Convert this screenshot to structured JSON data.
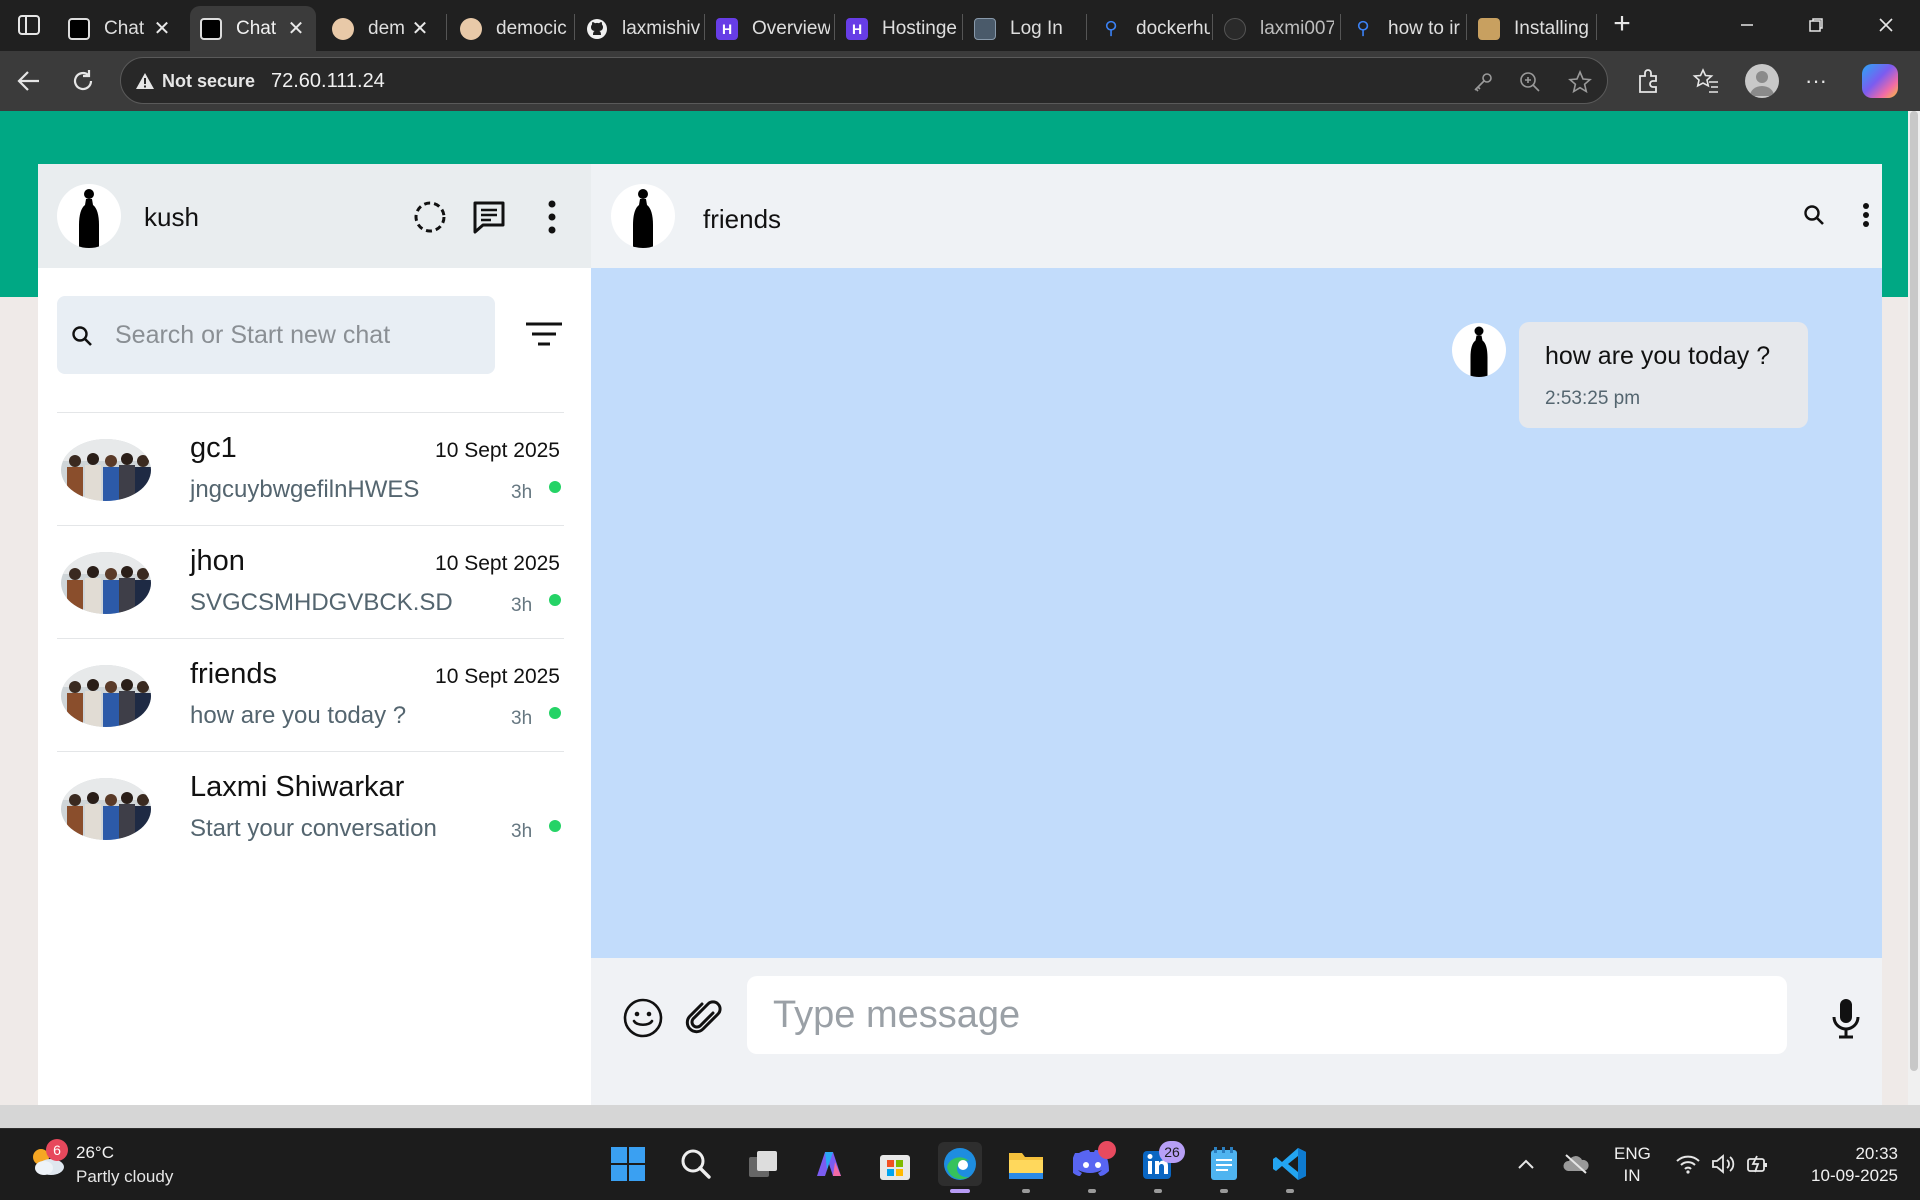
{
  "browser": {
    "tabs": [
      {
        "label": "Chat",
        "closable": true,
        "active": false
      },
      {
        "label": "Chat",
        "closable": true,
        "active": true
      },
      {
        "label": "dem",
        "closable": true,
        "active": false
      },
      {
        "label": "democic",
        "closable": false,
        "active": false
      },
      {
        "label": "laxmishiv",
        "closable": false,
        "active": false
      },
      {
        "label": "Overview",
        "closable": false,
        "active": false
      },
      {
        "label": "Hostinge",
        "closable": false,
        "active": false
      },
      {
        "label": "Log In",
        "closable": false,
        "active": false
      },
      {
        "label": "dockerhu",
        "closable": false,
        "active": false
      },
      {
        "label": "laxmi007",
        "closable": false,
        "active": false
      },
      {
        "label": "how to ir",
        "closable": false,
        "active": false
      },
      {
        "label": "Installing",
        "closable": false,
        "active": false
      }
    ],
    "security_label": "Not secure",
    "url": "72.60.111.24"
  },
  "app": {
    "colors": {
      "brand": "#00a884",
      "chat_bg": "#c2dcfb",
      "online": "#25d366"
    },
    "me": {
      "name": "kush"
    },
    "search": {
      "placeholder": "Search or Start new chat"
    },
    "chats": [
      {
        "name": "gc1",
        "date": "10 Sept 2025",
        "last_message": "jngcuybwgefilnHWES",
        "ago": "3h",
        "online": true
      },
      {
        "name": "jhon",
        "date": "10 Sept 2025",
        "last_message": "SVGCSMHDGVBCK.SD",
        "ago": "3h",
        "online": true
      },
      {
        "name": "friends",
        "date": "10 Sept 2025",
        "last_message": "how are you today ?",
        "ago": "3h",
        "online": true
      },
      {
        "name": "Laxmi Shiwarkar",
        "date": "",
        "last_message": "Start your conversation",
        "ago": "3h",
        "online": true
      }
    ],
    "active_chat": {
      "name": "friends",
      "messages": [
        {
          "text": "how are you today ?",
          "time": "2:53:25 pm",
          "outgoing": true
        }
      ]
    },
    "composer": {
      "placeholder": "Type message"
    }
  },
  "taskbar": {
    "weather": {
      "badge": "6",
      "temp": "26°C",
      "desc": "Partly cloudy"
    },
    "discord_badge": "",
    "linkedin_badge": "26",
    "lang_line1": "ENG",
    "lang_line2": "IN",
    "time": "20:33",
    "date": "10-09-2025"
  }
}
